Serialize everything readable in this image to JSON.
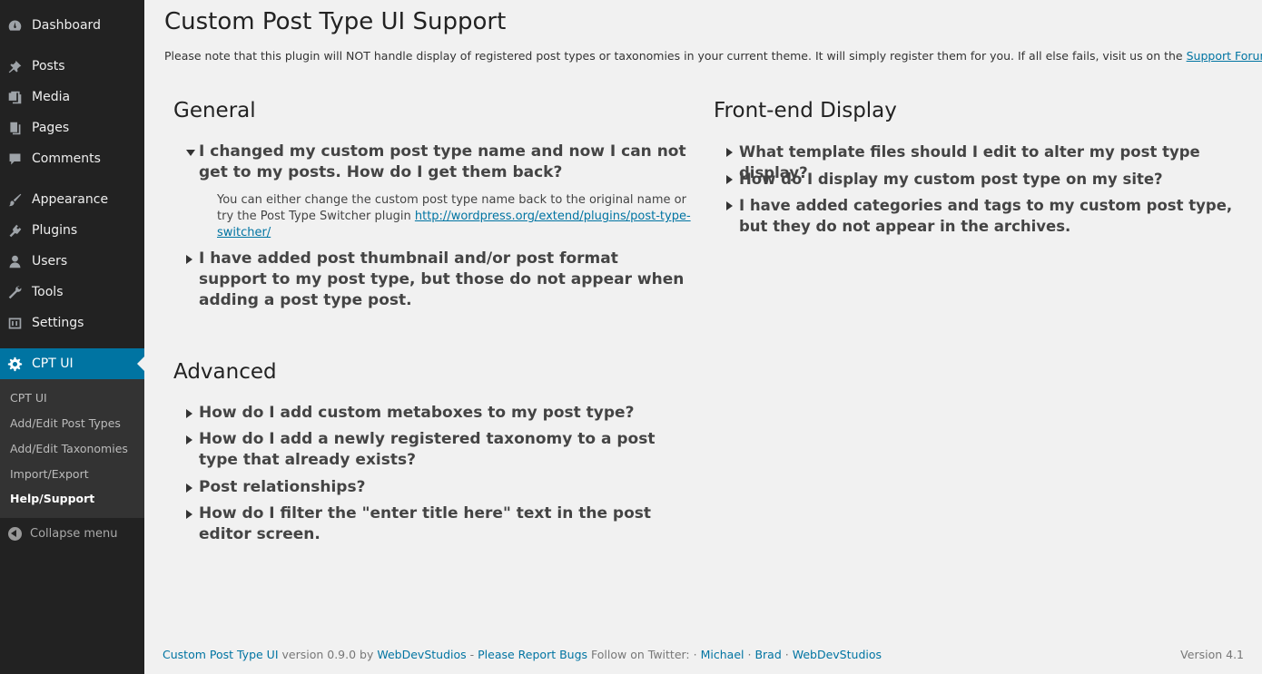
{
  "sidebar": {
    "menu": [
      {
        "label": "Dashboard",
        "icon": "dashboard-icon"
      },
      {
        "label": "Posts",
        "icon": "pushpin-icon"
      },
      {
        "label": "Media",
        "icon": "media-icon"
      },
      {
        "label": "Pages",
        "icon": "pages-icon"
      },
      {
        "label": "Comments",
        "icon": "comment-icon"
      },
      {
        "label": "Appearance",
        "icon": "paintbrush-icon"
      },
      {
        "label": "Plugins",
        "icon": "plugin-icon"
      },
      {
        "label": "Users",
        "icon": "user-icon"
      },
      {
        "label": "Tools",
        "icon": "wrench-icon"
      },
      {
        "label": "Settings",
        "icon": "settings-icon"
      },
      {
        "label": "CPT UI",
        "icon": "gear-icon"
      }
    ],
    "submenu": [
      "CPT UI",
      "Add/Edit Post Types",
      "Add/Edit Taxonomies",
      "Import/Export",
      "Help/Support"
    ],
    "collapse_label": "Collapse menu"
  },
  "page": {
    "title": "Custom Post Type UI Support",
    "intro": "Please note that this plugin will NOT handle display of registered post types or taxonomies in your current theme. It will simply register them for you. If all else fails, visit us on the",
    "intro_link": "Support Forums"
  },
  "general": {
    "title": "General",
    "q1": "I changed my custom post type name and now I can not get to my posts. How do I get them back?",
    "a1": "You can either change the custom post type name back to the original name or try the Post Type Switcher plugin",
    "a1_link": "http://wordpress.org/extend/plugins/post-type-switcher/",
    "q2": "I have added post thumbnail and/or post format support to my post type, but those do not appear when adding a post type post."
  },
  "advanced": {
    "title": "Advanced",
    "q1": "How do I add custom metaboxes to my post type?",
    "q2": "How do I add a newly registered taxonomy to a post type that already exists?",
    "q3": "Post relationships?",
    "q4": "How do I filter the \"enter title here\" text in the post editor screen."
  },
  "frontend": {
    "title": "Front-end Display",
    "q1": "What template files should I edit to alter my post type display?",
    "q2": "How do I display my custom post type on my site?",
    "q3": "I have added categories and tags to my custom post type, but they do not appear in the archives."
  },
  "footer": {
    "plugin_link": "Custom Post Type UI",
    "version_text": "version 0.9.0 by",
    "author_link": "WebDevStudios",
    "dash": "-",
    "bugs_link": "Please Report Bugs",
    "twitter_text": "Follow on Twitter:",
    "sep": "·",
    "michael": "Michael",
    "brad": "Brad",
    "wds": "WebDevStudios",
    "wp_version": "Version 4.1"
  },
  "colors": {
    "sidebar_bg": "#222222",
    "active_bg": "#0074a2",
    "link": "#0074a2",
    "page_bg": "#f1f1f1"
  }
}
